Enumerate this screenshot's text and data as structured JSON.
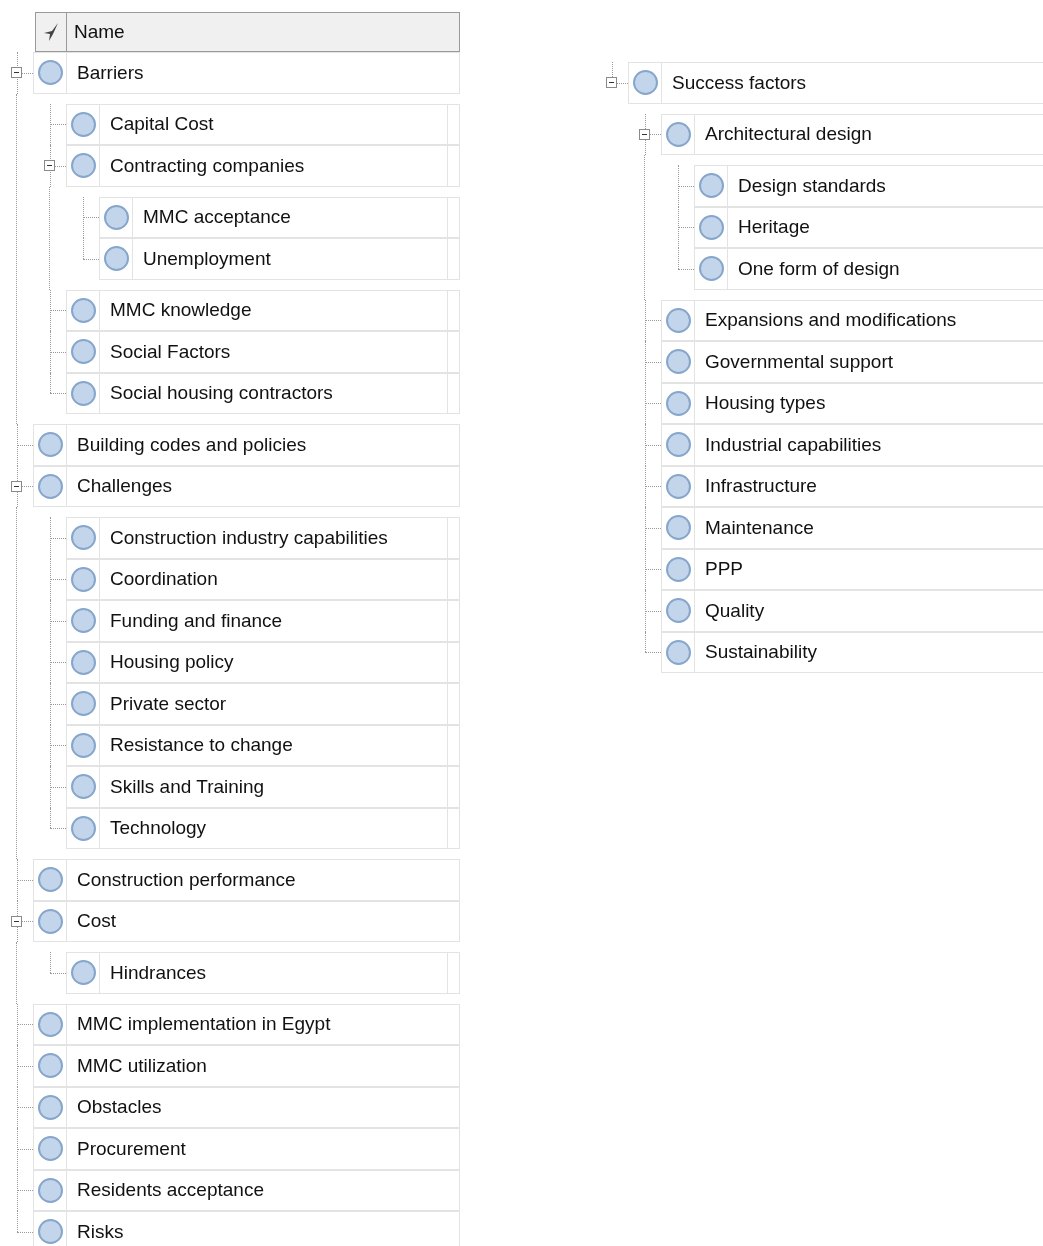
{
  "header": {
    "name_column": "Name"
  },
  "left_tree": [
    {
      "name": "Barriers",
      "expanded": true,
      "children": [
        {
          "name": "Capital Cost"
        },
        {
          "name": "Contracting companies",
          "expanded": true,
          "children": [
            {
              "name": "MMC acceptance"
            },
            {
              "name": "Unemployment"
            }
          ]
        },
        {
          "name": "MMC knowledge"
        },
        {
          "name": "Social Factors"
        },
        {
          "name": "Social housing contractors"
        }
      ]
    },
    {
      "name": "Building codes and policies"
    },
    {
      "name": "Challenges",
      "expanded": true,
      "children": [
        {
          "name": "Construction industry capabilities"
        },
        {
          "name": "Coordination"
        },
        {
          "name": "Funding and finance"
        },
        {
          "name": "Housing policy"
        },
        {
          "name": "Private sector"
        },
        {
          "name": "Resistance to change"
        },
        {
          "name": "Skills and Training"
        },
        {
          "name": "Technology"
        }
      ]
    },
    {
      "name": "Construction performance"
    },
    {
      "name": "Cost",
      "expanded": true,
      "children": [
        {
          "name": "Hindrances"
        }
      ]
    },
    {
      "name": "MMC implementation in Egypt"
    },
    {
      "name": "MMC utilization"
    },
    {
      "name": "Obstacles"
    },
    {
      "name": "Procurement"
    },
    {
      "name": "Residents acceptance"
    },
    {
      "name": "Risks"
    }
  ],
  "right_tree": [
    {
      "name": "Success factors",
      "expanded": true,
      "children": [
        {
          "name": "Architectural design",
          "expanded": true,
          "children": [
            {
              "name": "Design standards"
            },
            {
              "name": "Heritage"
            },
            {
              "name": "One form of design"
            }
          ]
        },
        {
          "name": "Expansions and modifications"
        },
        {
          "name": "Governmental support"
        },
        {
          "name": "Housing types"
        },
        {
          "name": "Industrial capabilities"
        },
        {
          "name": "Infrastructure"
        },
        {
          "name": "Maintenance"
        },
        {
          "name": "PPP"
        },
        {
          "name": "Quality"
        },
        {
          "name": "Sustainability"
        }
      ]
    }
  ]
}
